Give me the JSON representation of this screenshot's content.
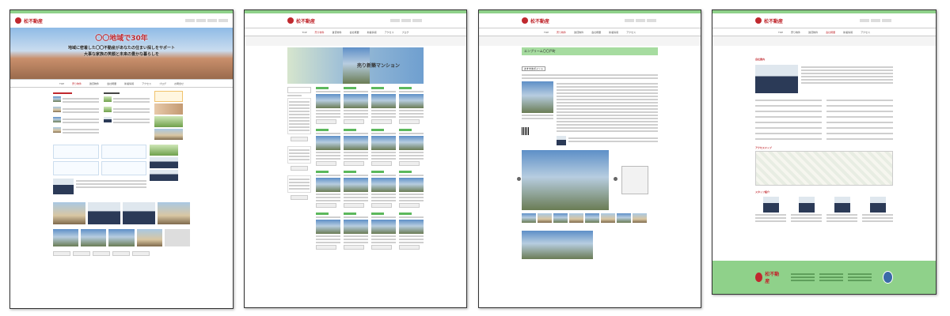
{
  "site": {
    "logo_text": "松不動産",
    "nav": [
      "TOP",
      "売り物件",
      "賃貸物件",
      "会社概要",
      "新着情報",
      "アクセス",
      "ブログ",
      "お問合せ",
      "採用情報",
      "よくある質問"
    ]
  },
  "home": {
    "hero_title": "〇〇地域で30年",
    "hero_sub1": "地域に密着した〇〇不動産があなたの住まい探しをサポート",
    "hero_sub2": "大事な家族の笑顔と未来の豊かな暮らしを"
  },
  "listing": {
    "banner_text": "売り新築マンション"
  },
  "detail": {
    "title": "エンブリーム〇〇戸町",
    "mention_button": "おすすめポイント"
  },
  "company": {
    "section_about": "会社案内",
    "section_access": "アクセスマップ",
    "section_staff": "スタッフ紹介",
    "footer_logo": "松不動産"
  }
}
